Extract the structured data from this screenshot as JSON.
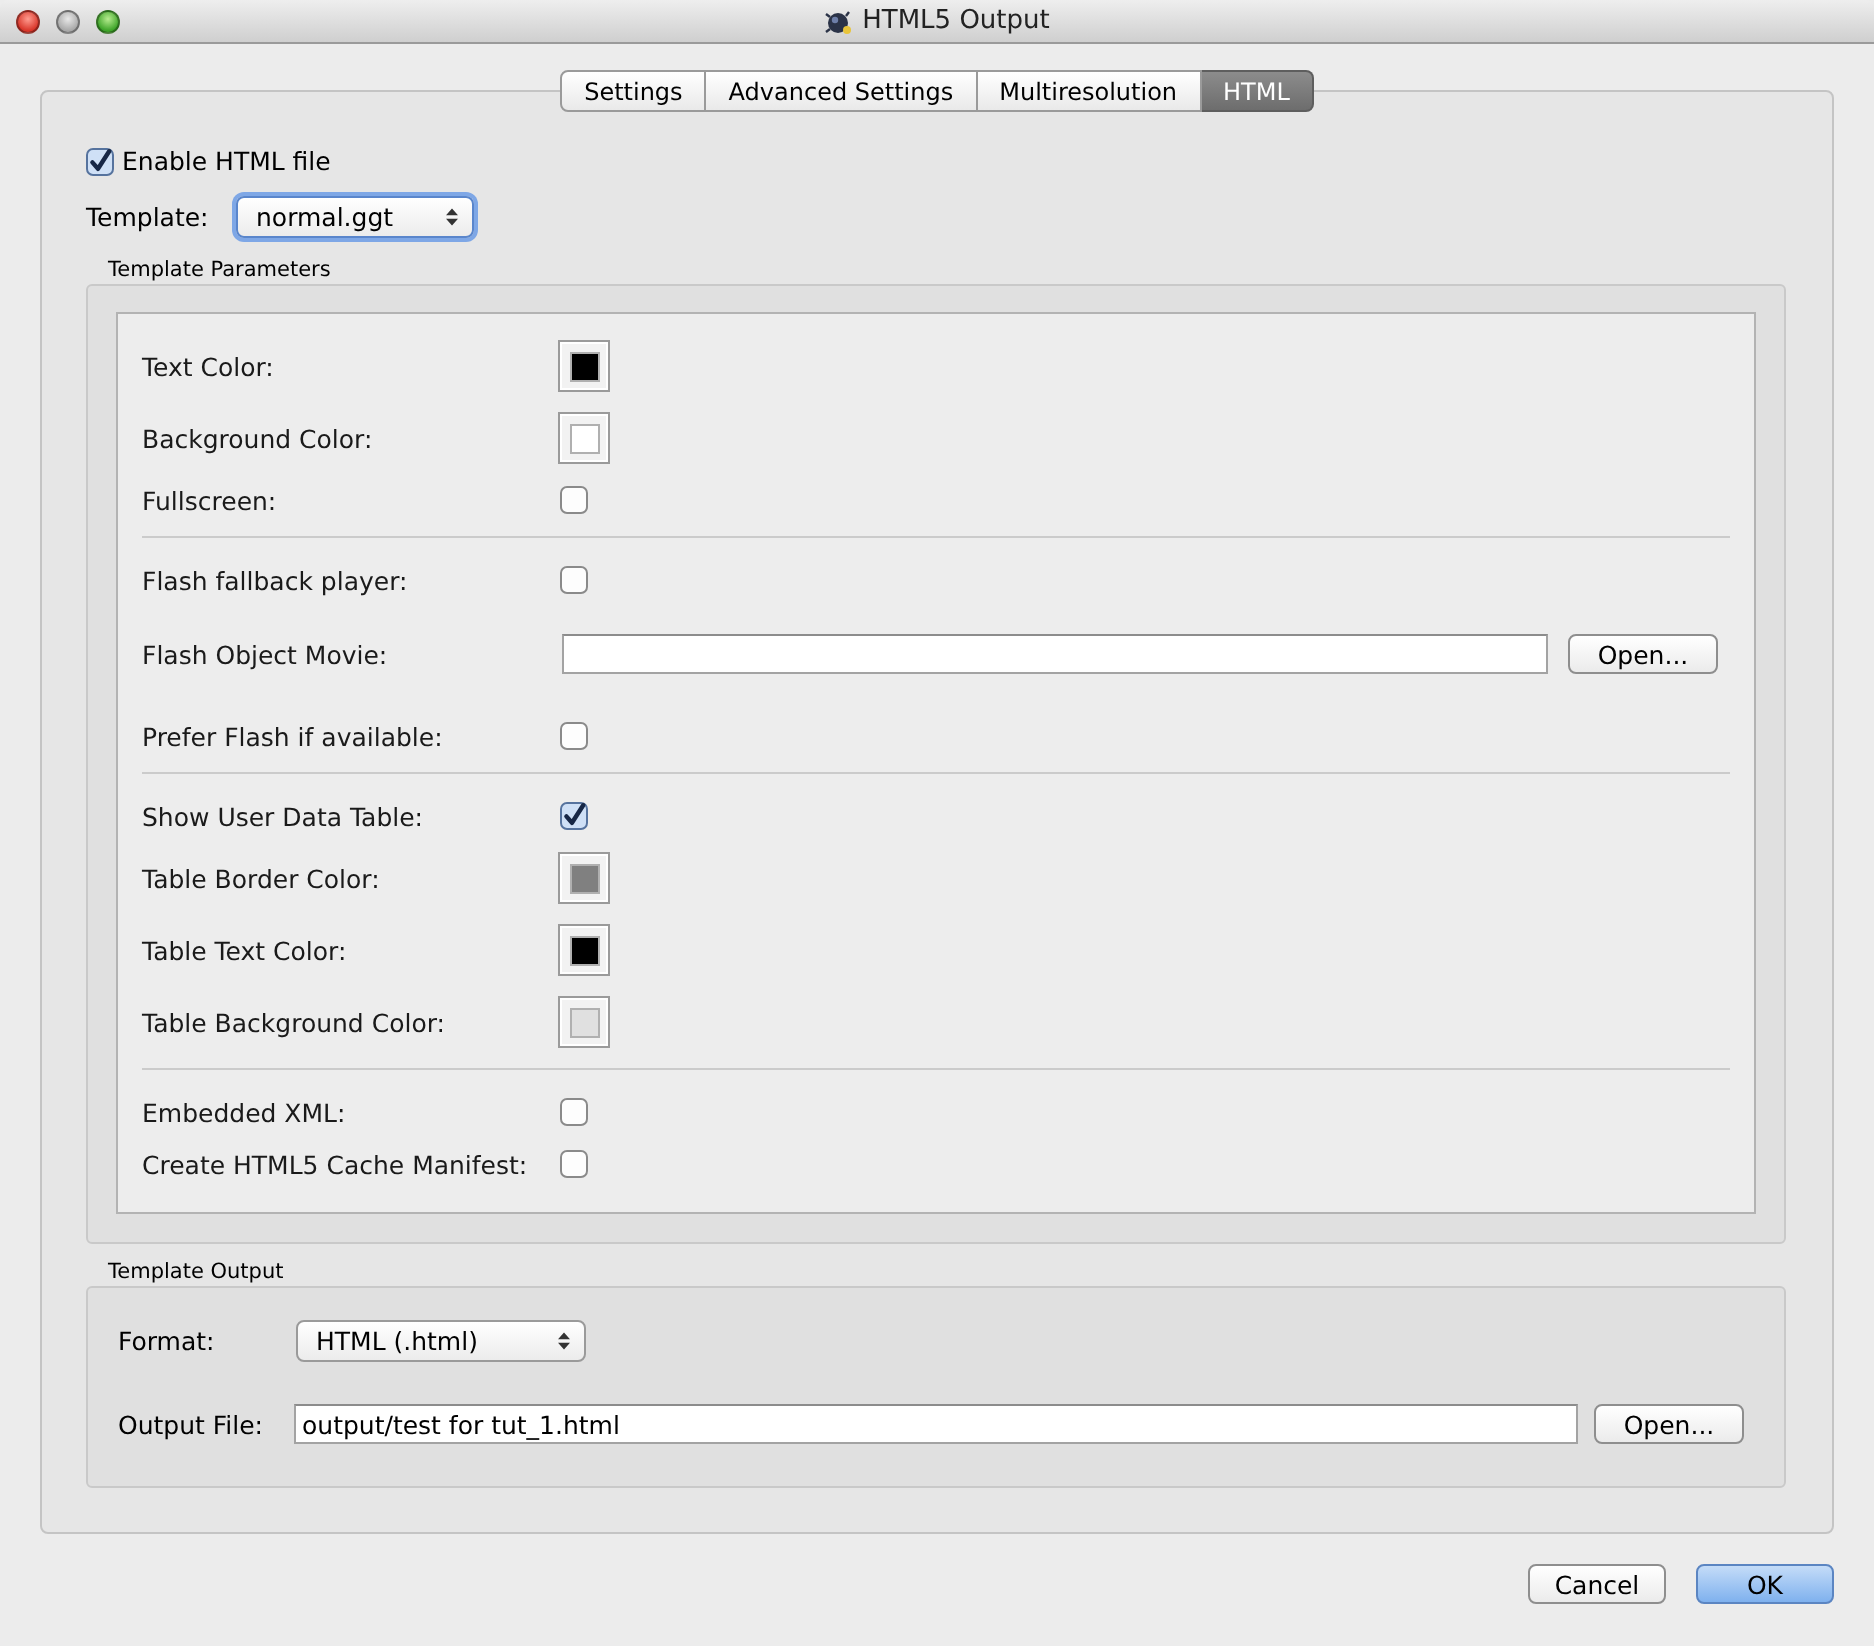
{
  "window": {
    "title": "HTML5 Output"
  },
  "tabs": [
    {
      "label": "Settings",
      "selected": false
    },
    {
      "label": "Advanced Settings",
      "selected": false
    },
    {
      "label": "Multiresolution",
      "selected": false
    },
    {
      "label": "HTML",
      "selected": true
    }
  ],
  "enable_html_file": {
    "label": "Enable HTML file",
    "checked": true
  },
  "template": {
    "label": "Template:",
    "value": "normal.ggt",
    "focused": true
  },
  "template_parameters": {
    "title": "Template Parameters",
    "sections": [
      {
        "rows": [
          {
            "kind": "color",
            "label": "Text Color:",
            "color": "#000000"
          },
          {
            "kind": "color",
            "label": "Background Color:",
            "color": "#ffffff"
          },
          {
            "kind": "checkbox",
            "label": "Fullscreen:",
            "checked": false
          }
        ]
      },
      {
        "rows": [
          {
            "kind": "checkbox",
            "label": "Flash fallback player:",
            "checked": false
          },
          {
            "kind": "file",
            "label": "Flash Object Movie:",
            "button": "Open..."
          },
          {
            "kind": "checkbox",
            "label": "Prefer Flash if available:",
            "checked": false
          }
        ]
      },
      {
        "rows": [
          {
            "kind": "checkbox",
            "label": "Show User Data Table:",
            "checked": true
          },
          {
            "kind": "color",
            "label": "Table Border Color:",
            "color": "#808080"
          },
          {
            "kind": "color",
            "label": "Table Text Color:",
            "color": "#000000"
          },
          {
            "kind": "color",
            "label": "Table Background Color:",
            "color": "#e0e0e0"
          }
        ]
      },
      {
        "rows": [
          {
            "kind": "checkbox",
            "label": "Embedded XML:",
            "checked": false
          },
          {
            "kind": "checkbox",
            "label": "Create HTML5 Cache Manifest:",
            "checked": false
          }
        ]
      }
    ]
  },
  "template_output": {
    "title": "Template Output",
    "format": {
      "label": "Format:",
      "value": "HTML (.html)"
    },
    "output_file": {
      "label": "Output File:",
      "value": "output/test for tut_1.html",
      "button": "Open..."
    }
  },
  "buttons": [
    {
      "label": "Cancel",
      "default": false
    },
    {
      "label": "OK",
      "default": true
    }
  ]
}
